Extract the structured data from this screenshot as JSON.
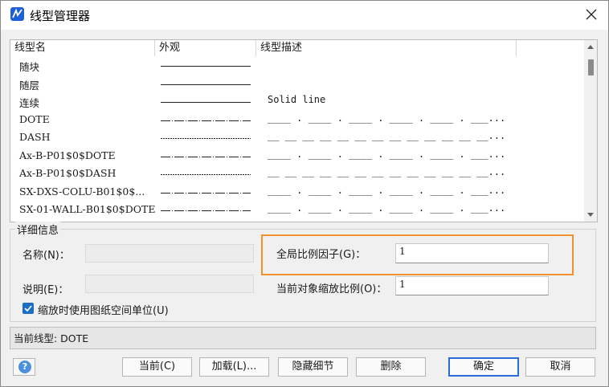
{
  "window": {
    "title": "线型管理器"
  },
  "list": {
    "columns": [
      "线型名",
      "外观",
      "线型描述"
    ],
    "rows": [
      {
        "name": "随块",
        "appearance": "solid",
        "description": ""
      },
      {
        "name": "随层",
        "appearance": "solid",
        "description": ""
      },
      {
        "name": "连续",
        "appearance": "solid",
        "description": "Solid line"
      },
      {
        "name": "DOTE",
        "appearance": "dashdot",
        "description": "____ . ____ . ____ . ____ . ____ . ___..."
      },
      {
        "name": "DASH",
        "appearance": "dash",
        "description": "__ __ __ __ __ __ __ __ __ __ __ __ __..."
      },
      {
        "name": "Ax-B-P01$0$DOTE",
        "appearance": "dashdot",
        "description": "____ . ____ . ____ . ____ . ____ . ___..."
      },
      {
        "name": "Ax-B-P01$0$DASH",
        "appearance": "dash",
        "description": "__ __ __ __ __ __ __ __ __ __ __ __ __..."
      },
      {
        "name": "SX-DXS-COLU-B01$0$...",
        "appearance": "dashdot",
        "description": "____ . ____ . ____ . ____ . ____ . ___..."
      },
      {
        "name": "SX-01-WALL-B01$0$DOTE",
        "appearance": "dashdot",
        "description": "____ . ____ . ____ . ____ . ____ . ___..."
      }
    ]
  },
  "details": {
    "legend": "详细信息",
    "name_label": "名称(N)：",
    "desc_label": "说明(E)：",
    "global_scale_label": "全局比例因子(G)：",
    "global_scale_value": "1",
    "object_scale_label": "当前对象缩放比例(O)：",
    "object_scale_value": "1",
    "paper_space_label": "缩放时使用图纸空间单位(U)",
    "paper_space_checked": true
  },
  "status": {
    "text": "当前线型: DOTE"
  },
  "buttons": {
    "current": "当前(C)",
    "load": "加载(L)...",
    "hide_details": "隐藏细节",
    "delete": "删除",
    "ok": "确定",
    "cancel": "取消"
  },
  "colors": {
    "accent": "#1b6ec2",
    "highlight": "#f0912b"
  }
}
